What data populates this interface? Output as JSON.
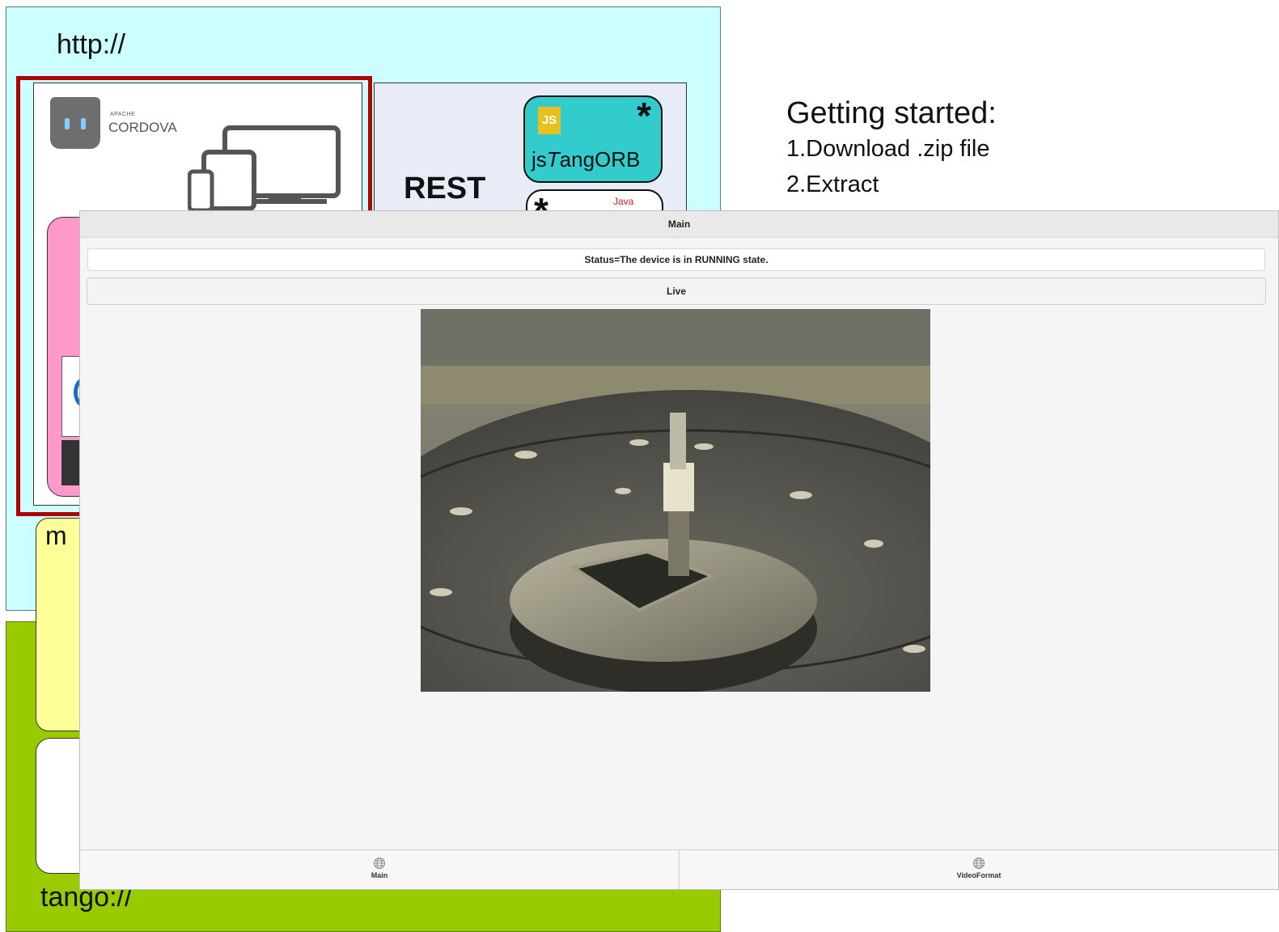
{
  "slide": {
    "http_label": "http://",
    "tango_label": "tango://",
    "cordova_apache": "APACHE",
    "cordova_name": "CORDOVA",
    "rest_label": "REST",
    "jstangorb_prefix": "js",
    "jstangorb_italic": "T",
    "jstangorb_suffix": "angORB",
    "js_badge": "JS",
    "java_label": "Java",
    "star": "*",
    "yellow_label": "m",
    "getting_started": {
      "title": "Getting started:",
      "steps": [
        "1.Download .zip file",
        "2.Extract"
      ]
    }
  },
  "app": {
    "header_title": "Main",
    "status": "Status=The device is in RUNNING state.",
    "live_button": "Live",
    "tabs": [
      {
        "label": "Main",
        "icon": "globe-icon"
      },
      {
        "label": "VideoFormat",
        "icon": "globe-icon"
      }
    ]
  },
  "colors": {
    "http_zone": "#ccffff",
    "tango_zone": "#99cc00",
    "red_frame": "#b00000",
    "jstangorb": "#33cccc",
    "pink": "#ff99cc",
    "yellow": "#ffff99"
  }
}
